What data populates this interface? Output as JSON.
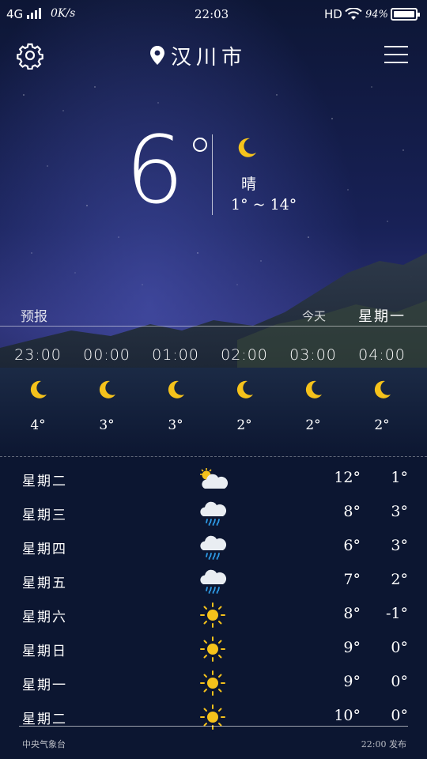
{
  "status_bar": {
    "network": "4G",
    "speed": "0K/s",
    "time": "22:03",
    "hd": "HD",
    "battery": "94%"
  },
  "header": {
    "city": "汉川市",
    "location_icon": "location-pin-icon",
    "settings_icon": "gear-icon",
    "menu_icon": "hamburger-menu-icon"
  },
  "current": {
    "temp": "6",
    "icon": "moon-icon",
    "condition": "晴",
    "range": "1° ~ 14°"
  },
  "forecast": {
    "title": "预报",
    "today": "今天",
    "weekday": "星期一"
  },
  "hourly": [
    {
      "time": "23:00",
      "icon": "moon-icon",
      "temp": "4°"
    },
    {
      "time": "00:00",
      "icon": "moon-icon",
      "temp": "3°"
    },
    {
      "time": "01:00",
      "icon": "moon-icon",
      "temp": "3°"
    },
    {
      "time": "02:00",
      "icon": "moon-icon",
      "temp": "2°"
    },
    {
      "time": "03:00",
      "icon": "moon-icon",
      "temp": "2°"
    },
    {
      "time": "04:00",
      "icon": "moon-icon",
      "temp": "2°"
    }
  ],
  "daily": [
    {
      "day": "星期二",
      "icon": "partly-cloudy-icon",
      "high": "12°",
      "low": "1°"
    },
    {
      "day": "星期三",
      "icon": "rain-cloud-icon",
      "high": "8°",
      "low": "3°"
    },
    {
      "day": "星期四",
      "icon": "rain-cloud-icon",
      "high": "6°",
      "low": "3°"
    },
    {
      "day": "星期五",
      "icon": "rain-cloud-icon",
      "high": "7°",
      "low": "2°"
    },
    {
      "day": "星期六",
      "icon": "sun-icon",
      "high": "8°",
      "low": "-1°"
    },
    {
      "day": "星期日",
      "icon": "sun-icon",
      "high": "9°",
      "low": "0°"
    },
    {
      "day": "星期一",
      "icon": "sun-icon",
      "high": "9°",
      "low": "0°"
    },
    {
      "day": "星期二",
      "icon": "sun-icon",
      "high": "10°",
      "low": "0°"
    }
  ],
  "footer": {
    "source": "中央气象台",
    "published": "22:00 发布"
  },
  "colors": {
    "accent_yellow": "#f5c21b",
    "cloud_white": "#e9edf2",
    "rain_blue": "#2e9be6"
  }
}
